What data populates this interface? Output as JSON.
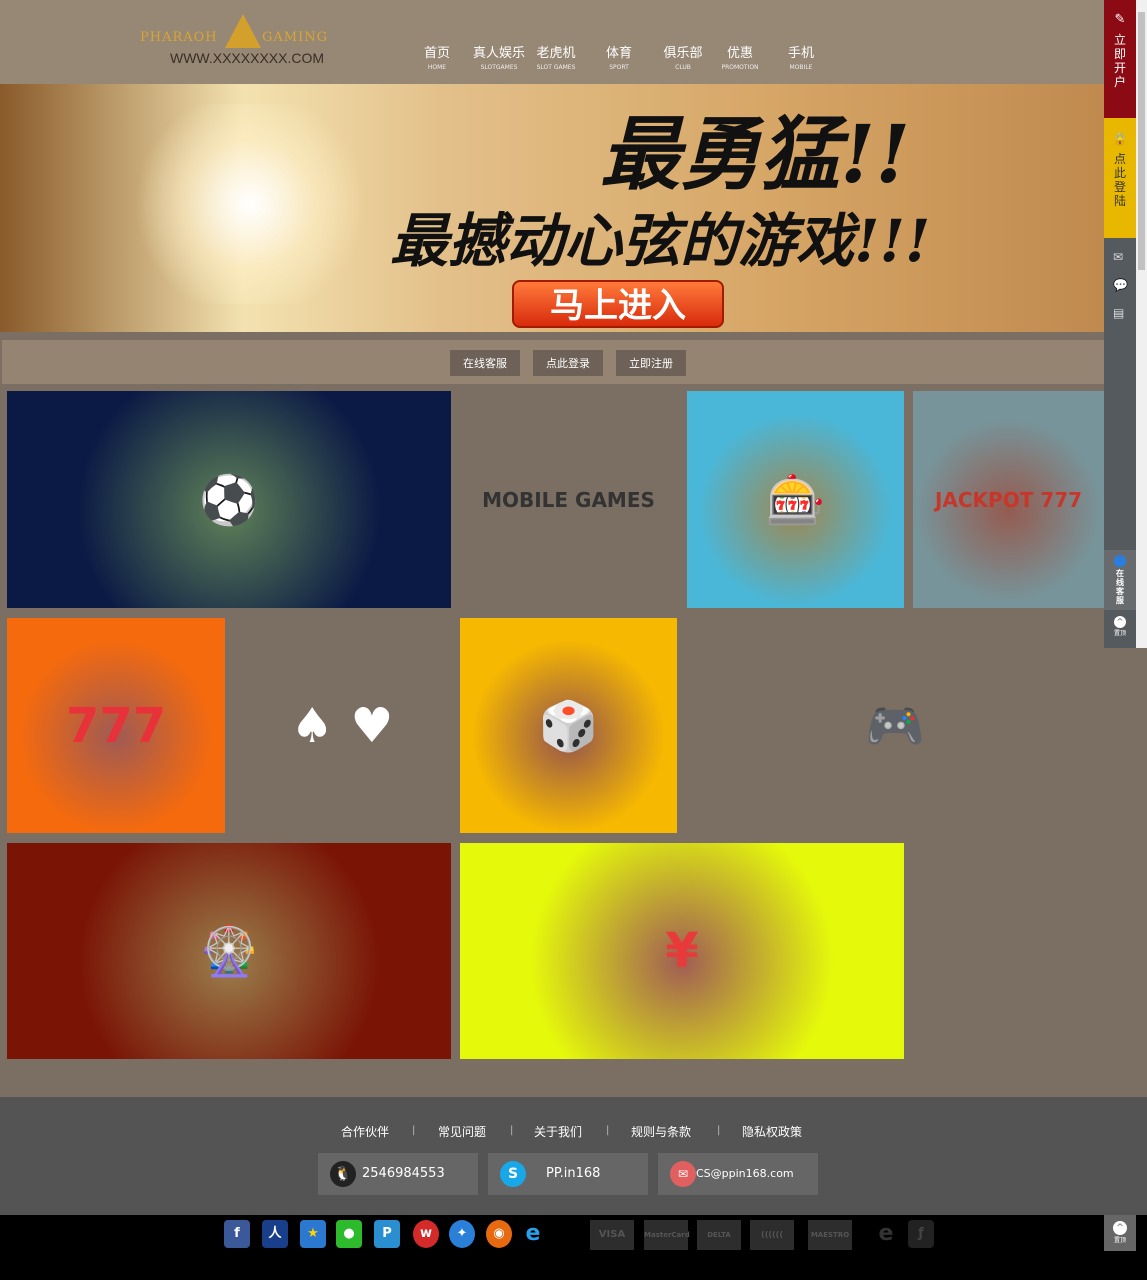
{
  "header": {
    "logo_left": "PHARAOH",
    "logo_right": "GAMING",
    "url": "WWW.XXXXXXXX.COM"
  },
  "nav": [
    {
      "cn": "首页",
      "en": "HOME"
    },
    {
      "cn": "真人娱乐",
      "en": "SLOTGAMES"
    },
    {
      "cn": "老虎机",
      "en": "SLOT GAMES"
    },
    {
      "cn": "体育",
      "en": "SPORT"
    },
    {
      "cn": "俱乐部",
      "en": "CLUB"
    },
    {
      "cn": "优惠",
      "en": "PROMOTION"
    },
    {
      "cn": "手机",
      "en": "MOBILE"
    }
  ],
  "banner": {
    "headline": "最勇猛!!",
    "subline": "最撼动心弦的游戏!!!",
    "enter": "马上进入"
  },
  "buttons": {
    "service": "在线客服",
    "login": "点此登录",
    "register": "立即注册"
  },
  "tiles": [
    {
      "name": "sports-betting",
      "color": "#0b1a45",
      "accent": "#27a844",
      "text": "⚽"
    },
    {
      "name": "mobile-games",
      "color": "#c8f1f8",
      "accent": "#333",
      "text": "MOBILE GAMES"
    },
    {
      "name": "roulette-chips",
      "color": "#4ab7d8",
      "accent": "#e7b92a",
      "text": "🎰"
    },
    {
      "name": "jackpot-777",
      "color": "#77949a",
      "accent": "#c7362b",
      "text": "JACKPOT 777"
    },
    {
      "name": "slot-777",
      "color": "#f56a0d",
      "accent": "#e8323a",
      "text": "777"
    },
    {
      "name": "playing-cards",
      "color": "#1ea4e6",
      "accent": "#fff",
      "text": "♠ ♥"
    },
    {
      "name": "casino-girl",
      "color": "#f6b800",
      "accent": "#c41d24",
      "text": "🎲"
    },
    {
      "name": "casino-mobile",
      "color": "#03aefc",
      "accent": "#333",
      "text": "🎮"
    },
    {
      "name": "golden-roulette",
      "color": "#7a1405",
      "accent": "#d9a020",
      "text": "🎡"
    },
    {
      "name": "red-envelope",
      "color": "#e5f90a",
      "accent": "#e83a3a",
      "text": "¥"
    }
  ],
  "footer": {
    "links": [
      "合作伙伴",
      "常见问题",
      "关于我们",
      "规则与条款",
      "隐私权政策"
    ],
    "qq": "2546984553",
    "skype": "PP.in168",
    "email": "CS@ppin168.com"
  },
  "sidebar": {
    "register": "立即开户",
    "login": "点此登陆",
    "service": "在线客服",
    "top": "置顶"
  },
  "bottom_icons": [
    "facebook",
    "renren",
    "qzone",
    "wechat",
    "pp",
    "weibo",
    "safari",
    "firefox",
    "ie"
  ],
  "payments": [
    "VISA",
    "MasterCard",
    "DELTA",
    "((((((",
    "MAESTRO"
  ]
}
